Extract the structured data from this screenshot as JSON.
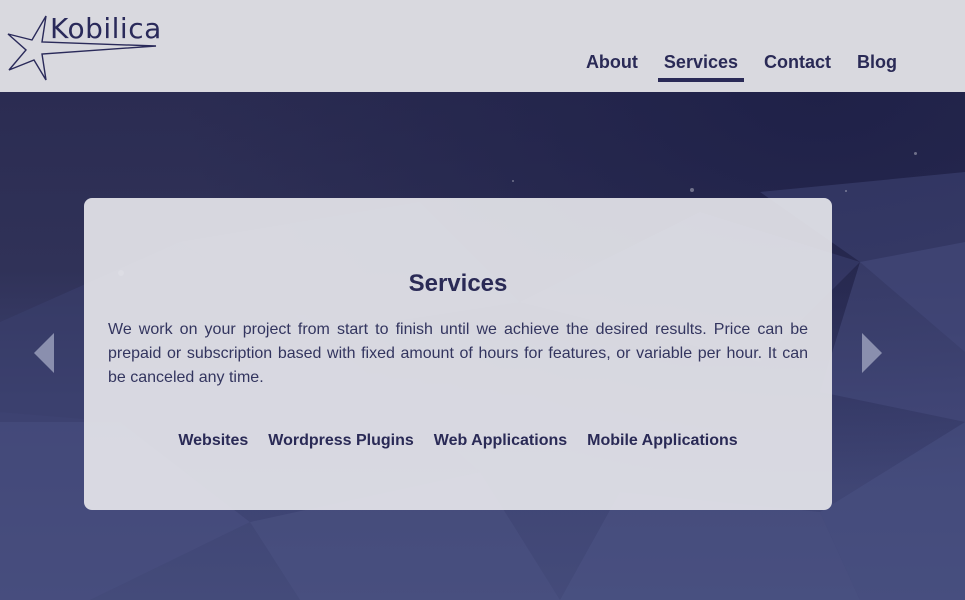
{
  "header": {
    "logo_text": "Kobilica",
    "logo_icon": "star-icon",
    "nav": [
      {
        "label": "About",
        "active": false
      },
      {
        "label": "Services",
        "active": true
      },
      {
        "label": "Contact",
        "active": false
      },
      {
        "label": "Blog",
        "active": false
      }
    ]
  },
  "slide": {
    "title": "Services",
    "description": "We work on your project from start to finish until we achieve the desired results. Price can be prepaid or subscription based with fixed amount of hours for features, or variable per hour. It can be canceled any time.",
    "links": [
      "Websites",
      "Wordpress Plugins",
      "Web Applications",
      "Mobile Applications"
    ]
  },
  "carousel": {
    "prev_icon": "chevron-left-icon",
    "next_icon": "chevron-right-icon"
  },
  "colors": {
    "header_bg": "#d9d9df",
    "brand": "#2a2a56",
    "hero_bg": "#2c2f55"
  }
}
